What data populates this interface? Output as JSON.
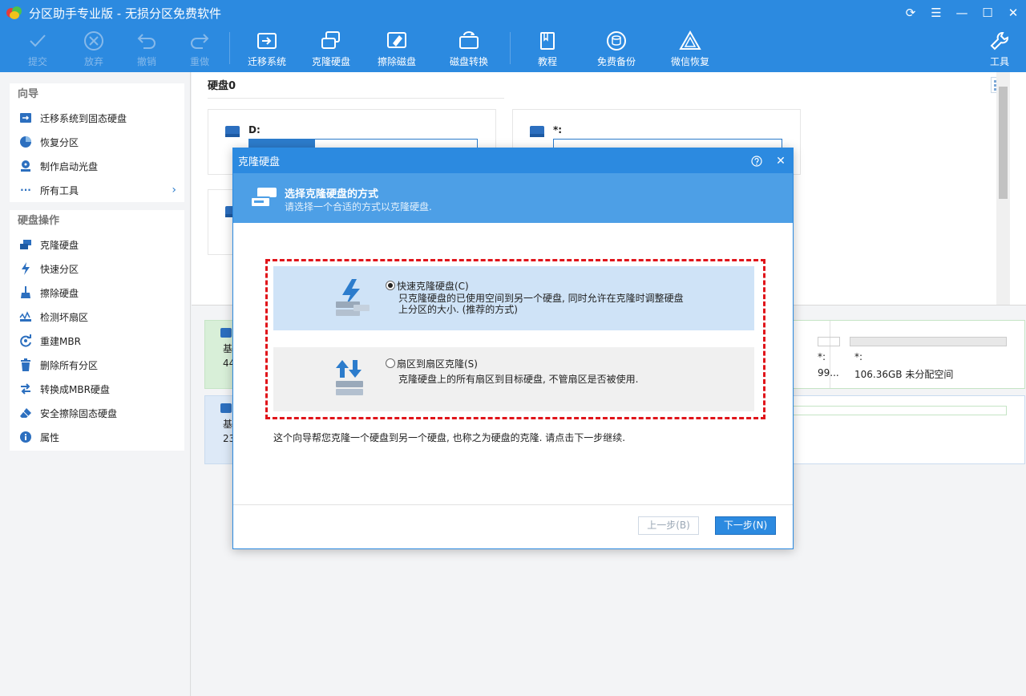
{
  "window": {
    "title": "分区助手专业版 - 无损分区免费软件"
  },
  "toolbar": {
    "items": [
      {
        "label": "提交",
        "icon": "check-icon"
      },
      {
        "label": "放弃",
        "icon": "cancel-icon"
      },
      {
        "label": "撤销",
        "icon": "undo-icon"
      },
      {
        "label": "重做",
        "icon": "redo-icon"
      },
      {
        "label": "迁移系统",
        "icon": "migrate-icon"
      },
      {
        "label": "克隆硬盘",
        "icon": "clone-disk-icon"
      },
      {
        "label": "擦除磁盘",
        "icon": "wipe-disk-icon"
      },
      {
        "label": "磁盘转换",
        "icon": "convert-disk-icon"
      },
      {
        "label": "教程",
        "icon": "book-icon"
      },
      {
        "label": "免费备份",
        "icon": "backup-icon"
      },
      {
        "label": "微信恢复",
        "icon": "recover-icon"
      },
      {
        "label": "工具",
        "icon": "wrench-icon"
      }
    ]
  },
  "sidebar": {
    "wizard": {
      "title": "向导",
      "items": [
        {
          "label": "迁移系统到固态硬盘"
        },
        {
          "label": "恢复分区"
        },
        {
          "label": "制作启动光盘"
        },
        {
          "label": "所有工具"
        }
      ]
    },
    "disk_ops": {
      "title": "硬盘操作",
      "items": [
        {
          "label": "克隆硬盘"
        },
        {
          "label": "快速分区"
        },
        {
          "label": "擦除硬盘"
        },
        {
          "label": "检测坏扇区"
        },
        {
          "label": "重建MBR"
        },
        {
          "label": "删除所有分区"
        },
        {
          "label": "转换成MBR硬盘"
        },
        {
          "label": "安全擦除固态硬盘"
        },
        {
          "label": "属性"
        }
      ]
    }
  },
  "main": {
    "disk_header": "硬盘0",
    "partitions": [
      {
        "label": "D:",
        "used_fraction": 0.29
      },
      {
        "label": "*:"
      }
    ],
    "bottom": {
      "row1_basic": "基",
      "row1_size": "44",
      "row1_part_star1": "*:",
      "row1_part_size1": "99...",
      "row1_part_star2": "*:",
      "row1_part_size2": "106.36GB 未分配空间",
      "row2_basic": "基",
      "row2_size": "23"
    }
  },
  "dialog": {
    "title": "克隆硬盘",
    "header_title": "选择克隆硬盘的方式",
    "header_sub": "请选择一个合适的方式以克隆硬盘.",
    "option1": {
      "title": "快速克隆硬盘(C)",
      "desc": "只克隆硬盘的已使用空间到另一个硬盘, 同时允许在克隆时调整硬盘上分区的大小. (推荐的方式)",
      "selected": true
    },
    "option2": {
      "title": "扇区到扇区克隆(S)",
      "desc": "克隆硬盘上的所有扇区到目标硬盘, 不管扇区是否被使用."
    },
    "footnote": "这个向导帮您克隆一个硬盘到另一个硬盘, 也称之为硬盘的克隆. 请点击下一步继续.",
    "btn_prev": "上一步(B)",
    "btn_next": "下一步(N)"
  }
}
